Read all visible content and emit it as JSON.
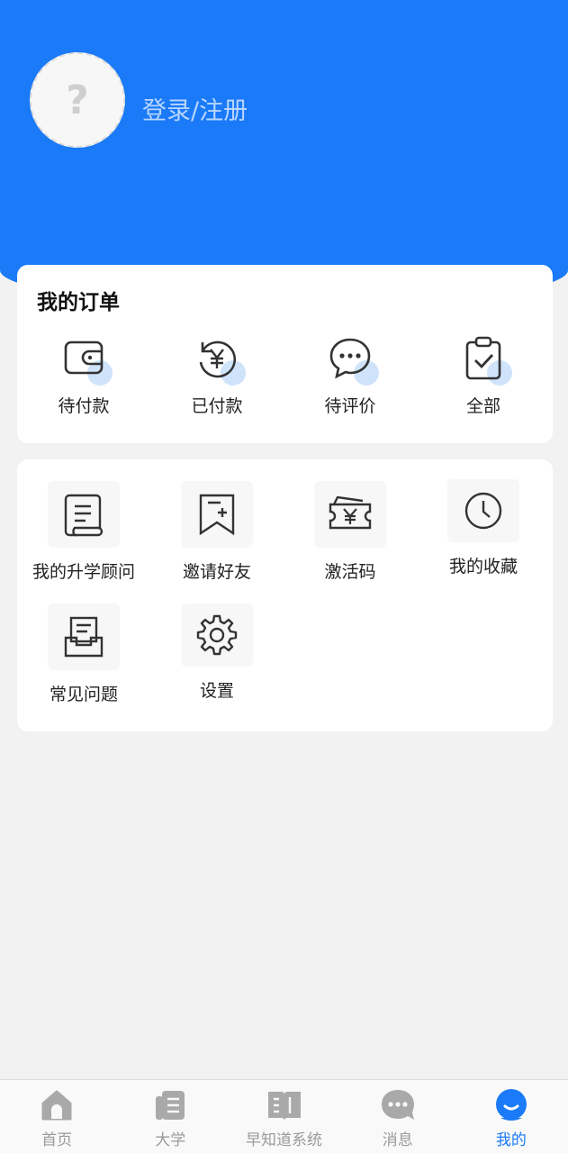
{
  "profile": {
    "avatar_glyph": "?",
    "login_label": "登录/注册"
  },
  "orders": {
    "title": "我的订单",
    "items": [
      {
        "label": "待付款",
        "icon": "wallet-icon"
      },
      {
        "label": "已付款",
        "icon": "yen-refresh-icon"
      },
      {
        "label": "待评价",
        "icon": "chat-bubble-icon"
      },
      {
        "label": "全部",
        "icon": "clipboard-check-icon"
      }
    ]
  },
  "services": {
    "items": [
      {
        "label": "我的升学顾问",
        "icon": "document-scroll-icon"
      },
      {
        "label": "邀请好友",
        "icon": "bookmark-plus-icon"
      },
      {
        "label": "激活码",
        "icon": "ticket-yen-icon"
      },
      {
        "label": "我的收藏",
        "icon": "clock-icon"
      },
      {
        "label": "常见问题",
        "icon": "inbox-tray-icon"
      },
      {
        "label": "设置",
        "icon": "gear-icon"
      }
    ]
  },
  "tabbar": {
    "active": "我的",
    "items": [
      {
        "label": "首页",
        "icon": "home-icon"
      },
      {
        "label": "大学",
        "icon": "book-stack-icon"
      },
      {
        "label": "早知道系统",
        "icon": "open-book-icon"
      },
      {
        "label": "消息",
        "icon": "message-icon"
      },
      {
        "label": "我的",
        "icon": "profile-icon"
      }
    ]
  },
  "colors": {
    "primary": "#1a7af8",
    "icon_tint": "#cfe3fb",
    "background": "#f2f2f2"
  }
}
